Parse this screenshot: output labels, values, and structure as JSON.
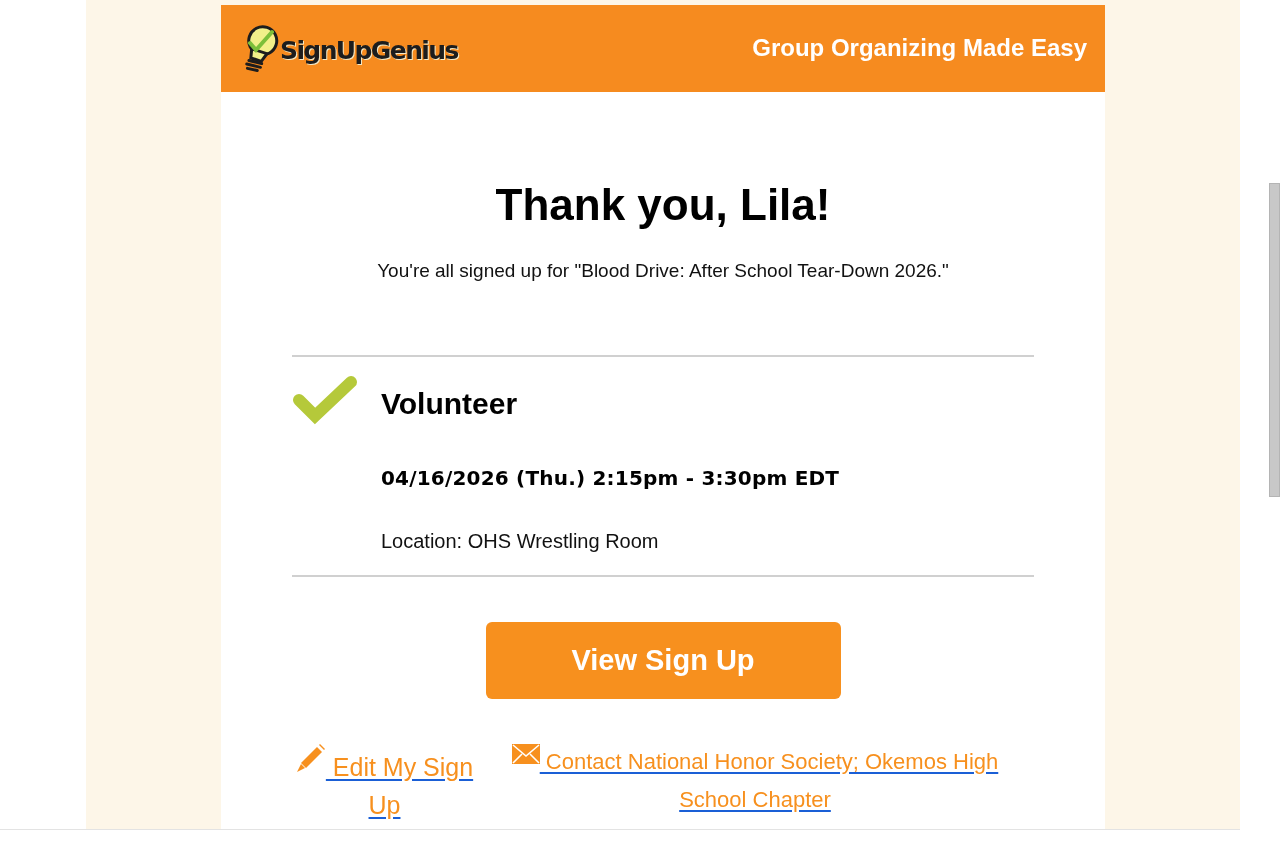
{
  "header": {
    "logo_text": "SignUpGenius",
    "tagline": "Group Organizing Made Easy"
  },
  "title": "Thank you, Lila!",
  "message": "You're all signed up for \"Blood Drive: After School Tear-Down 2026.\"",
  "slots": [
    {
      "name": "Volunteer",
      "datetime": "04/16/2026 (Thu.) 2:15pm - 3:30pm EDT",
      "location": "Location: OHS Wrestling Room"
    }
  ],
  "primary_button": "View Sign Up",
  "links": [
    {
      "kind": "edit",
      "label": "Edit My Sign Up"
    },
    {
      "kind": "contact",
      "label": "Contact National Honor Society; Okemos High School Chapter"
    }
  ]
}
